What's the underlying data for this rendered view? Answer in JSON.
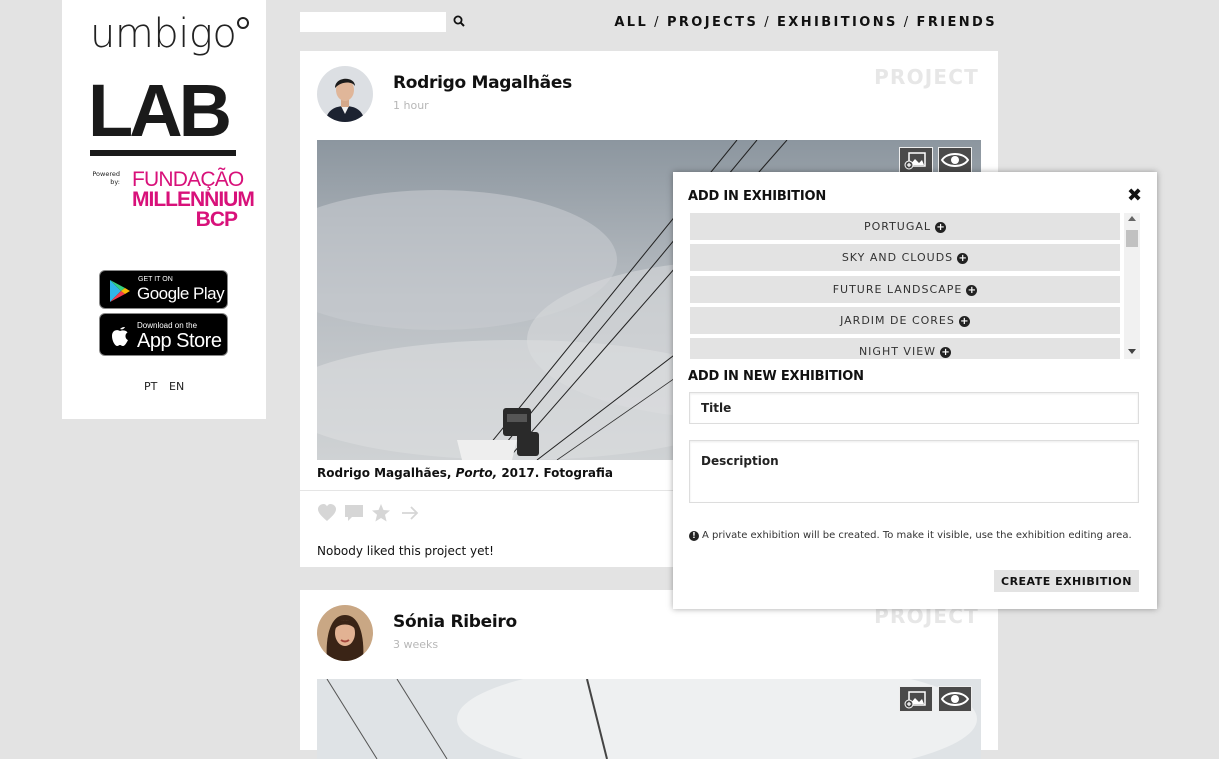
{
  "sidebar": {
    "logo_word": "umbigo",
    "logo_lab": "LAB",
    "powered_by": "Powered by:",
    "sponsor_line1": "FUNDAÇÃO",
    "sponsor_line2": "MILLENNIUM",
    "sponsor_line3": "BCP",
    "google_play_small": "GET IT ON",
    "google_play_big": "Google Play",
    "app_store_small": "Download on the",
    "app_store_big": "App Store",
    "lang_pt": "PT",
    "lang_en": "EN"
  },
  "search": {
    "placeholder": ""
  },
  "nav": {
    "all": "ALL",
    "projects": "PROJECTS",
    "exhibitions": "EXHIBITIONS",
    "friends": "FRIENDS",
    "separator": "/"
  },
  "posts": [
    {
      "author": "Rodrigo Magalhães",
      "time": "1 hour",
      "type": "PROJECT",
      "caption_author": "Rodrigo Magalhães,",
      "caption_title": "Porto,",
      "caption_year": "2017.",
      "caption_medium": "Fotografia",
      "likes_text": "Nobody liked this project yet!"
    },
    {
      "author": "Sónia Ribeiro",
      "time": "3 weeks",
      "type": "PROJECT"
    }
  ],
  "modal": {
    "add_in_exhibition": "ADD IN EXHIBITION",
    "close": "✖",
    "exhibitions": [
      "PORTUGAL",
      "SKY AND CLOUDS",
      "FUTURE LANDSCAPE",
      "JARDIM DE CORES",
      "NIGHT VIEW"
    ],
    "add_in_new": "ADD IN NEW EXHIBITION",
    "title_placeholder": "Title",
    "description_placeholder": "Description",
    "info_text": "A private exhibition will be created. To make it visible, use the exhibition editing area.",
    "create_button": "CREATE EXHIBITION"
  },
  "colors": {
    "accent": "#d8117a",
    "background": "#e3e3e3"
  }
}
